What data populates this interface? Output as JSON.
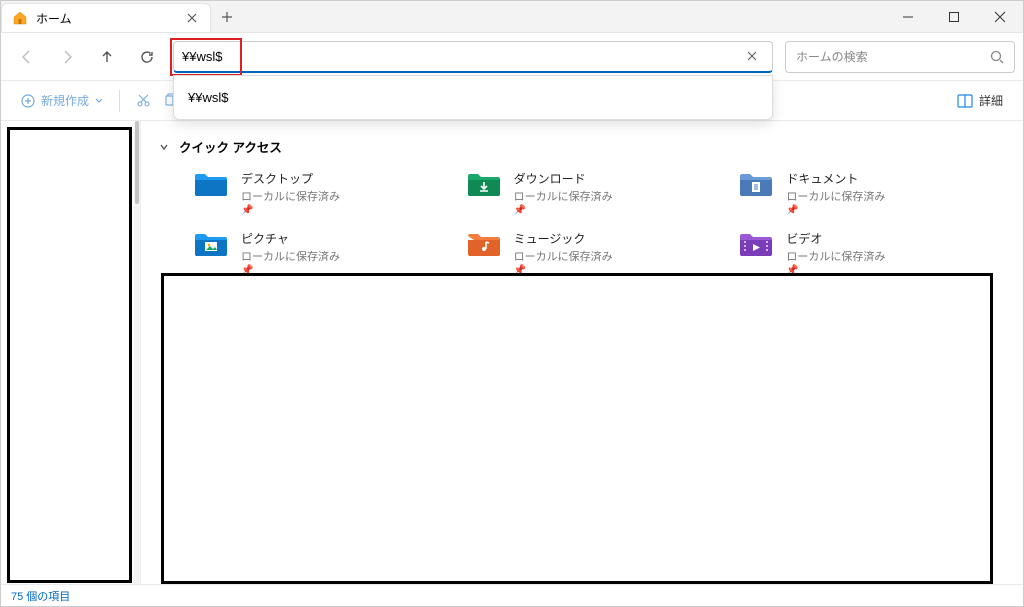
{
  "title_tab": "ホーム",
  "address": {
    "value": "¥¥wsl$",
    "suggestion": "¥¥wsl$"
  },
  "search": {
    "placeholder": "ホームの検索"
  },
  "toolbar": {
    "new_label": "新規作成",
    "detail_label": "詳細"
  },
  "quick_access": {
    "heading": "クイック アクセス",
    "items": [
      {
        "name": "デスクトップ",
        "sub": "ローカルに保存済み",
        "pin": "📌",
        "icon": "desktop"
      },
      {
        "name": "ダウンロード",
        "sub": "ローカルに保存済み",
        "pin": "📌",
        "icon": "download"
      },
      {
        "name": "ドキュメント",
        "sub": "ローカルに保存済み",
        "pin": "📌",
        "icon": "document"
      },
      {
        "name": "ピクチャ",
        "sub": "ローカルに保存済み",
        "pin": "📌",
        "icon": "picture"
      },
      {
        "name": "ミュージック",
        "sub": "ローカルに保存済み",
        "pin": "📌",
        "icon": "music"
      },
      {
        "name": "ビデオ",
        "sub": "ローカルに保存済み",
        "pin": "📌",
        "icon": "video"
      }
    ]
  },
  "status": "75 個の項目"
}
